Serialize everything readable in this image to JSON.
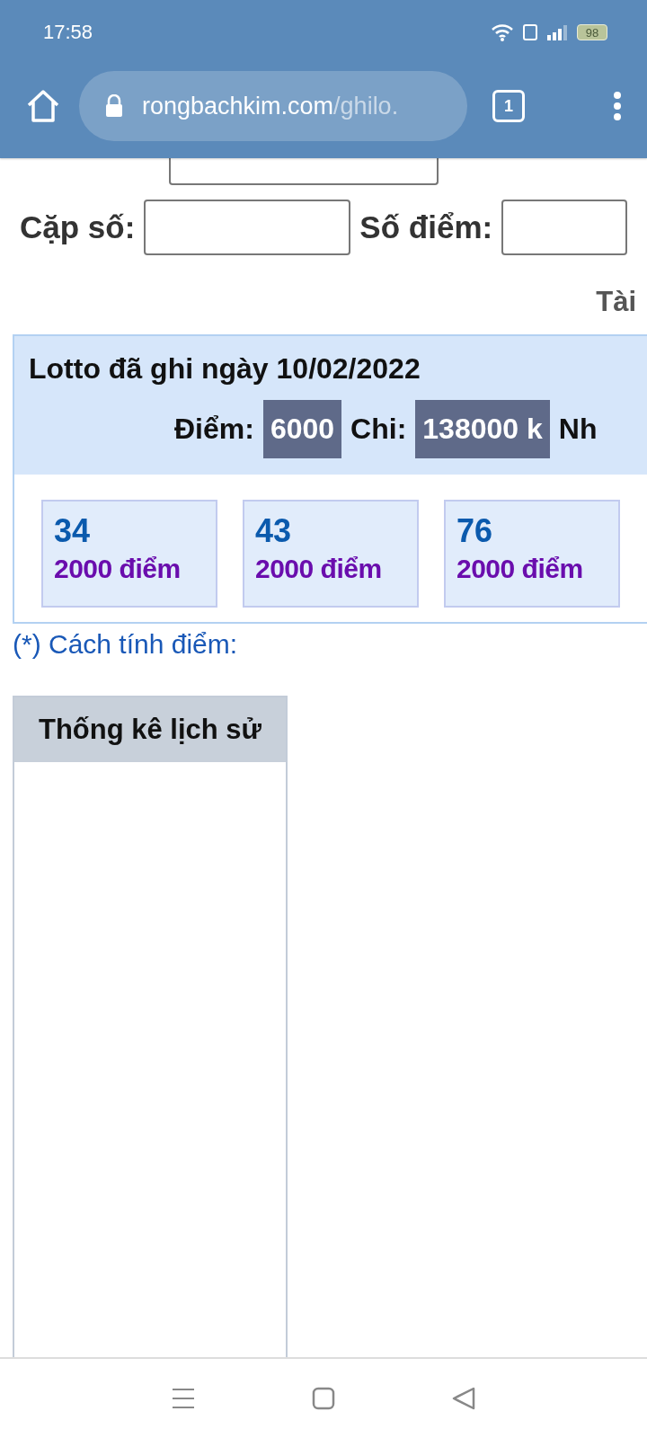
{
  "status_bar": {
    "time": "17:58",
    "battery": "98"
  },
  "browser": {
    "url_host": "rongbachkim.com",
    "url_path": "/ghilo.",
    "tab_count": "1"
  },
  "form": {
    "pair_label": "Cặp số:",
    "points_label": "Số điểm:"
  },
  "account_link": "Tài",
  "lotto_panel": {
    "title": "Lotto đã ghi ngày 10/02/2022",
    "points_label": "Điểm:",
    "points_value": "6000",
    "cost_label": "Chi:",
    "cost_value": "138000 k",
    "cut_label": "Nh",
    "entries": [
      {
        "number": "34",
        "points": "2000 điểm"
      },
      {
        "number": "43",
        "points": "2000 điểm"
      },
      {
        "number": "76",
        "points": "2000 điểm"
      }
    ]
  },
  "scoring_link": "(*) Cách tính điểm:",
  "history_table": {
    "header": "Thống kê lịch sử"
  }
}
